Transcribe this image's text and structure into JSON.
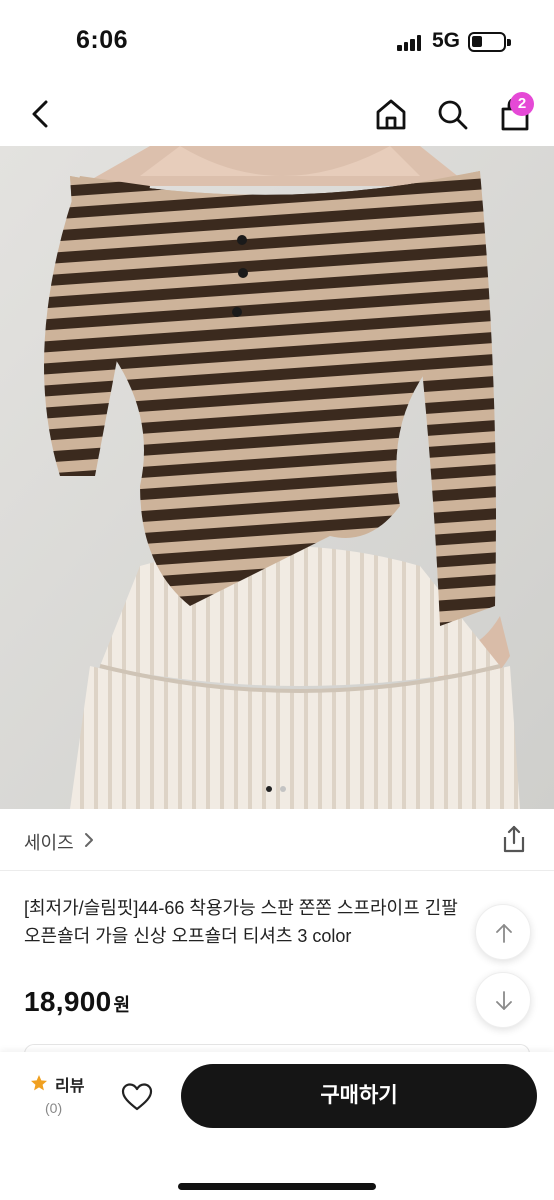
{
  "status_bar": {
    "time": "6:06",
    "network": "5G"
  },
  "nav": {
    "back_icon": "chevron-left-icon",
    "home_icon": "home-icon",
    "search_icon": "search-icon",
    "cart_icon": "shopping-bag-icon",
    "cart_badge": "2",
    "badge_color": "#e549d6"
  },
  "product": {
    "image_slides": 2,
    "active_slide": 1,
    "brand": "세이즈",
    "brand_chevron_icon": "chevron-right-icon",
    "share_icon": "share-icon",
    "title_line1": "[최저가/슬림핏]44-66 착용가능 스판 쫀쫀 스프라이프 긴팔",
    "title_line2": "오픈숄더 가을 신상 오프숄더 티셔츠 3 color",
    "price": "18,900",
    "currency": "원"
  },
  "scroll_buttons": {
    "up_icon": "arrow-up-icon",
    "down_icon": "arrow-down-icon"
  },
  "bottom_bar": {
    "review_icon": "star-icon",
    "review_label": "리뷰",
    "review_count": "(0)",
    "wishlist_icon": "heart-icon",
    "buy_label": "구매하기",
    "buy_color": "#151515",
    "star_color": "#f0a020"
  }
}
